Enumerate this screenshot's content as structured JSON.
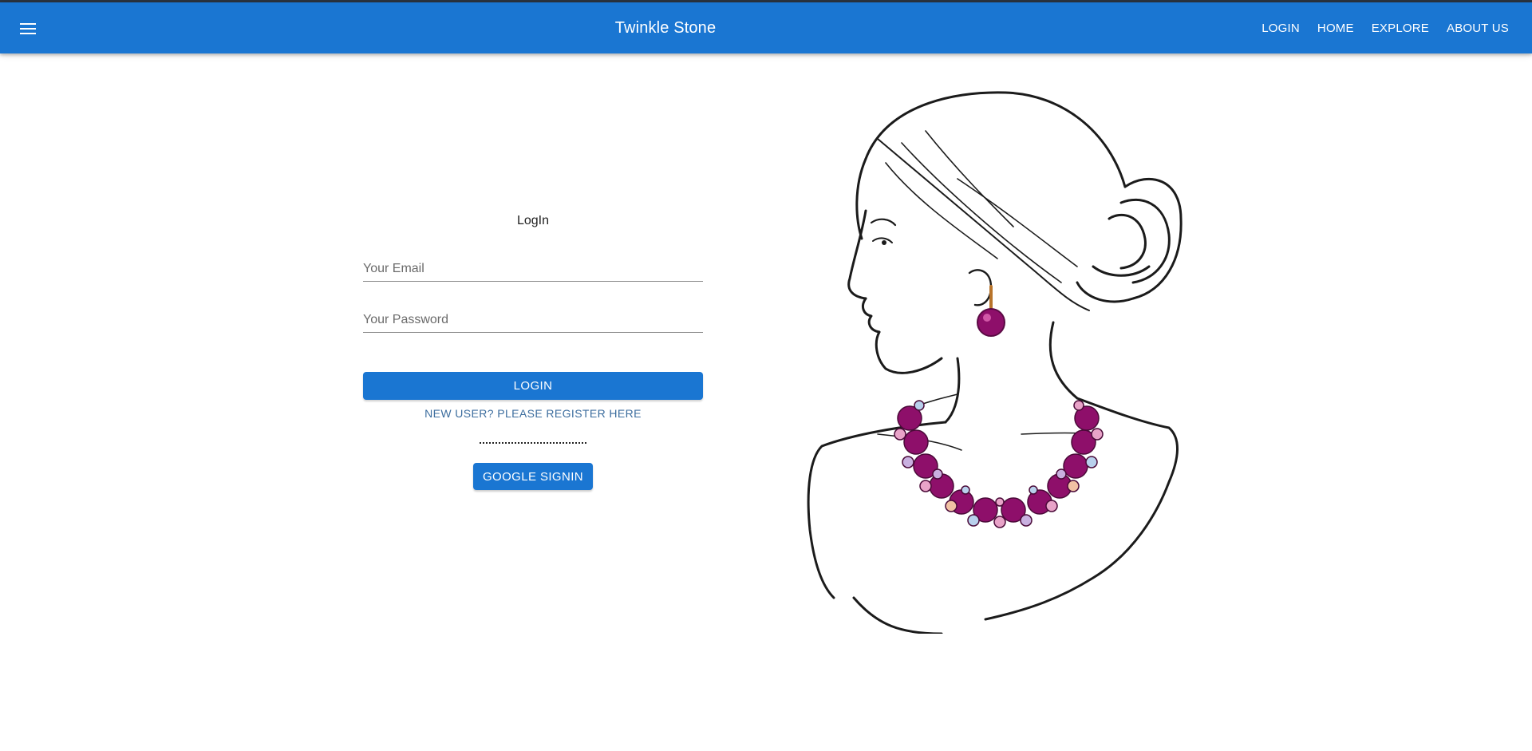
{
  "app": {
    "title": "Twinkle Stone",
    "accent_color": "#1a76d2"
  },
  "header": {
    "menu_icon": "hamburger-menu-icon",
    "nav": [
      {
        "label": "LOGIN"
      },
      {
        "label": "HOME"
      },
      {
        "label": "EXPLORE"
      },
      {
        "label": "ABOUT US"
      }
    ]
  },
  "login_form": {
    "title": "LogIn",
    "email": {
      "placeholder": "Your Email",
      "value": ""
    },
    "password": {
      "placeholder": "Your Password",
      "value": ""
    },
    "login_button": "LOGIN",
    "register_link": "NEW USER? PLEASE REGISTER HERE",
    "google_button": "GOOGLE SIGNIN"
  },
  "illustration": {
    "subject": "woman-profile-with-jewelry-illustration",
    "gem_color": "#8e0f6a"
  }
}
